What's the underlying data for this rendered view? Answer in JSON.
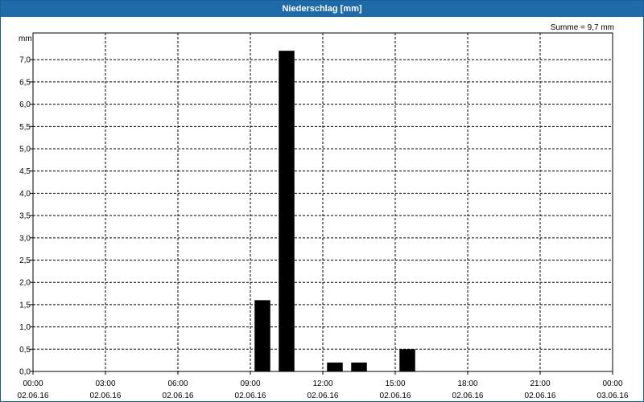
{
  "window": {
    "title": "Niederschlag [mm]"
  },
  "summary": "Summe = 9,7 mm",
  "chart_data": {
    "type": "bar",
    "title": "Niederschlag [mm]",
    "ylabel": "mm",
    "xlabel": "",
    "ylim": [
      0,
      7.6
    ],
    "y_ticks": [
      "0,0",
      "0,5",
      "1,0",
      "1,5",
      "2,0",
      "2,5",
      "3,0",
      "3,5",
      "4,0",
      "4,5",
      "5,0",
      "5,5",
      "6,0",
      "6,5",
      "7,0"
    ],
    "x_range_hours": [
      0,
      24
    ],
    "x_ticks": [
      {
        "time": "00:00",
        "date": "02.06.16"
      },
      {
        "time": "03:00",
        "date": "02.06.16"
      },
      {
        "time": "06:00",
        "date": "02.06.16"
      },
      {
        "time": "09:00",
        "date": "02.06.16"
      },
      {
        "time": "12:00",
        "date": "02.06.16"
      },
      {
        "time": "15:00",
        "date": "02.06.16"
      },
      {
        "time": "18:00",
        "date": "02.06.16"
      },
      {
        "time": "21:00",
        "date": "02.06.16"
      },
      {
        "time": "00:00",
        "date": "03.06.16"
      }
    ],
    "series": [
      {
        "values": [
          {
            "hour": 9,
            "value": 1.6
          },
          {
            "hour": 10,
            "value": 7.2
          },
          {
            "hour": 12,
            "value": 0.2
          },
          {
            "hour": 13,
            "value": 0.2
          },
          {
            "hour": 15,
            "value": 0.5
          }
        ]
      }
    ],
    "grid": true,
    "bar_color": "#000000"
  }
}
